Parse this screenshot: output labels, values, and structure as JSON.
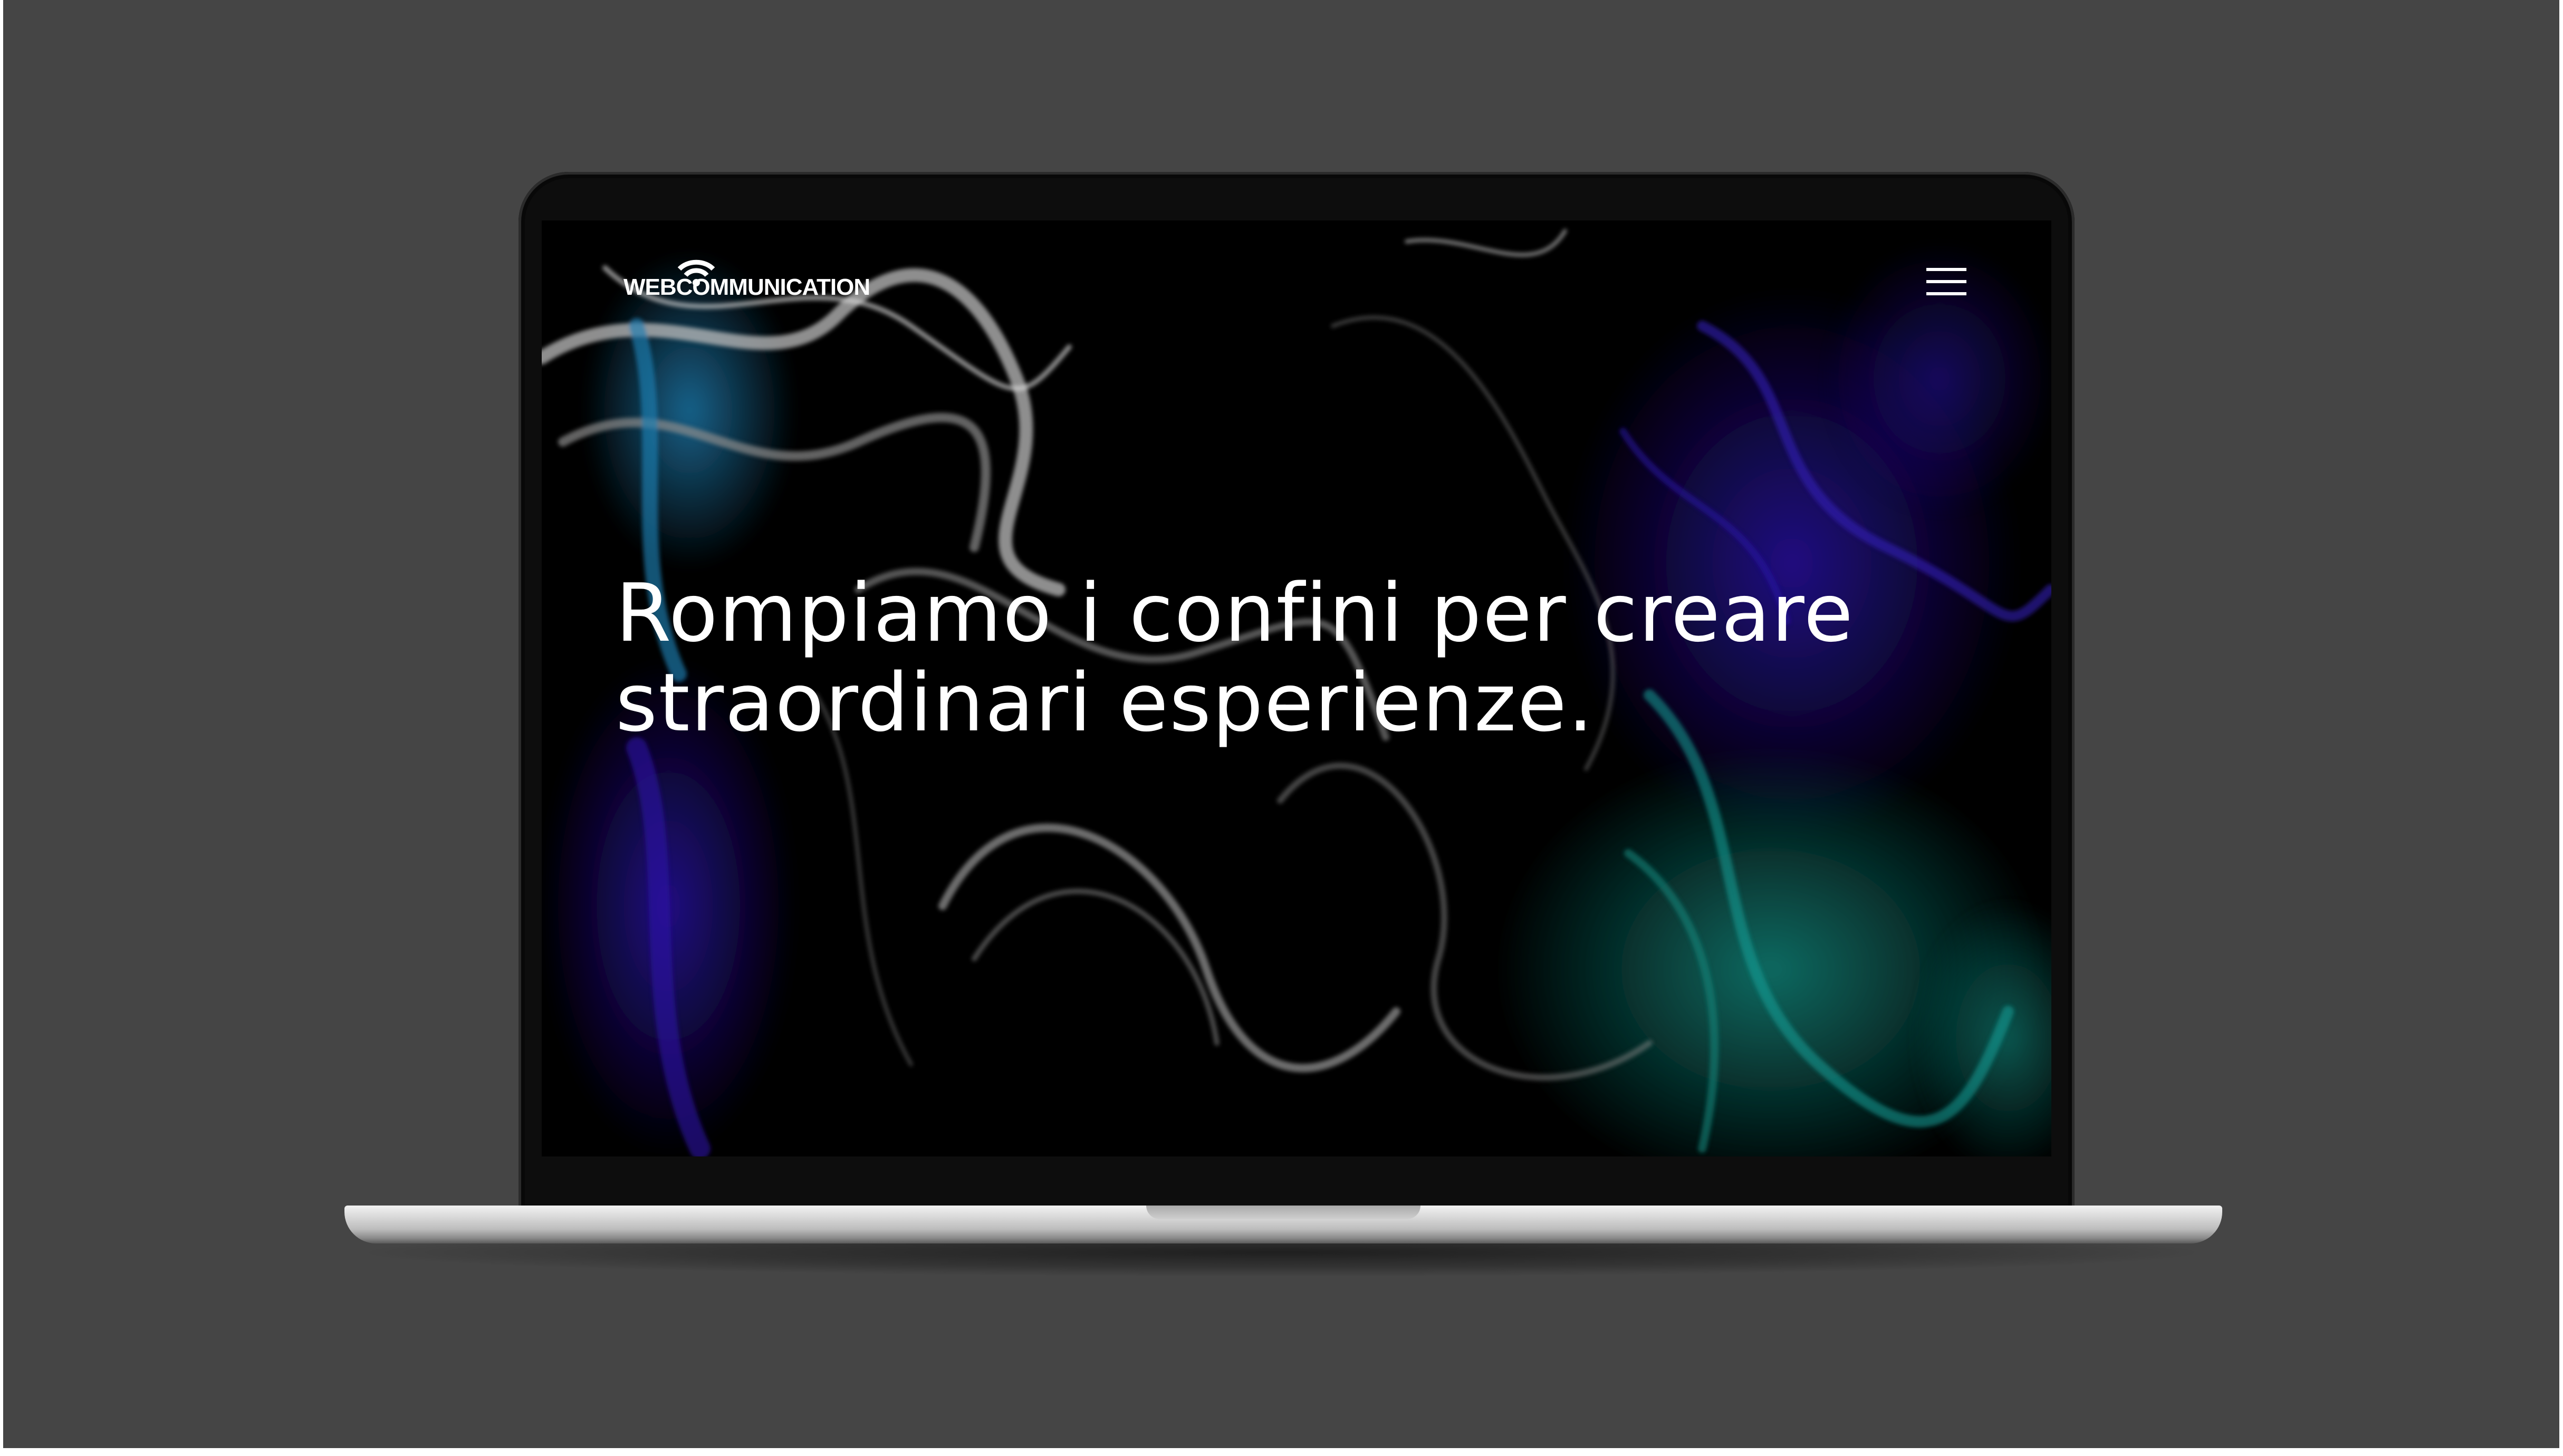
{
  "brand": {
    "logo_text": "WEBCOMMUNICATION",
    "logo_icon": "wifi-signal-icon",
    "logo_color": "#ffffff"
  },
  "nav": {
    "menu_icon": "hamburger-menu-icon"
  },
  "hero": {
    "headline_line1": "Rompiamo i confini per creare",
    "headline_line2": "straordinari esperienze.",
    "text_color": "#ffffff"
  },
  "theme": {
    "page_background": "#454545",
    "screen_background": "#000000",
    "accent_blue": "#1e2a9c",
    "accent_teal": "#0f6f66",
    "accent_cyan": "#1c6f9c",
    "accent_silver": "#9a9a9a"
  }
}
